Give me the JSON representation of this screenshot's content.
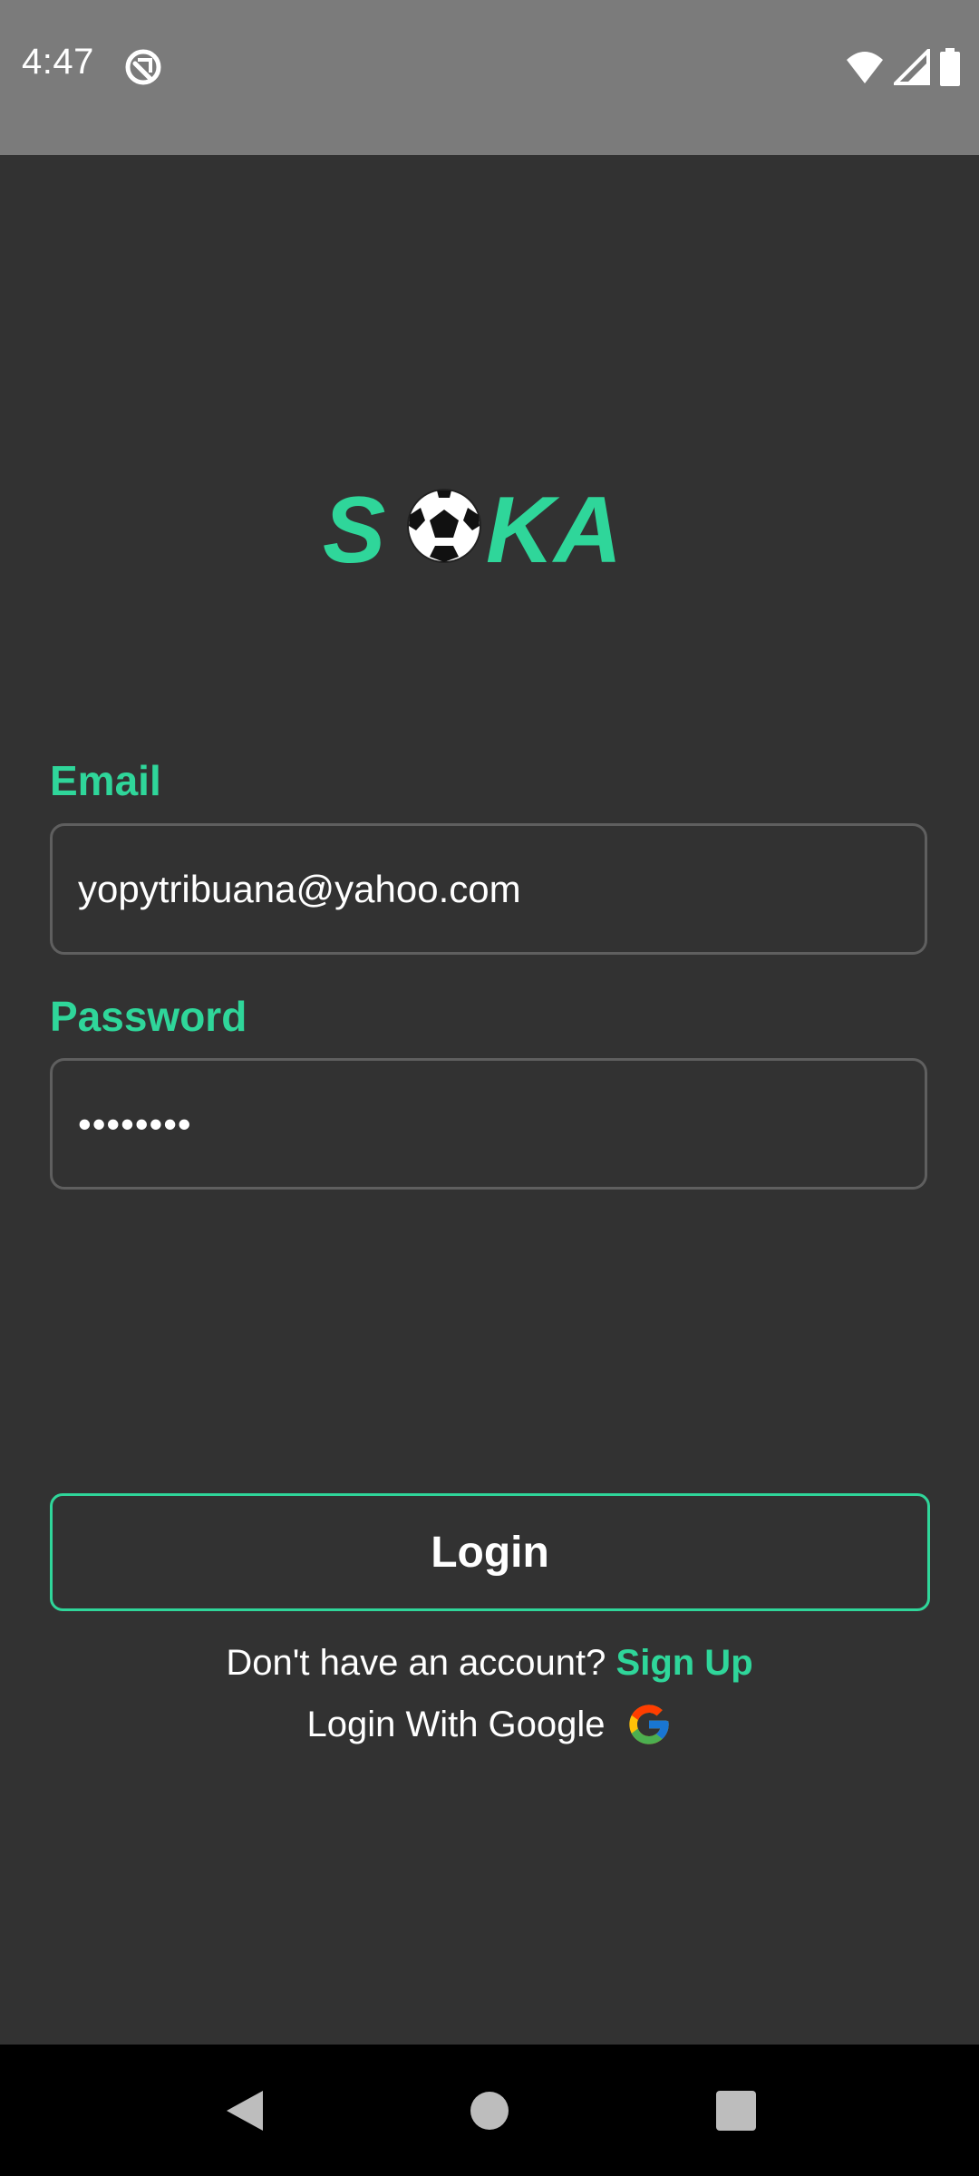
{
  "status_bar": {
    "time": "4:47"
  },
  "app": {
    "logo_text": "SOKA"
  },
  "form": {
    "email_label": "Email",
    "email_value": "yopytribuana@yahoo.com",
    "password_label": "Password",
    "password_value": "••••••••"
  },
  "actions": {
    "login_label": "Login",
    "signup_prompt": "Don't have an account?",
    "signup_link": "Sign Up",
    "google_label": "Login With Google"
  },
  "colors": {
    "accent": "#2fd69a",
    "background": "#323232",
    "status_bar": "#7b7b7b",
    "nav_bar": "#000000"
  },
  "icons": {
    "status_sync": "sync-off-icon",
    "wifi": "wifi-icon",
    "signal": "cell-signal-icon",
    "battery": "battery-icon",
    "google": "google-g-icon",
    "back": "back-triangle-icon",
    "home": "home-circle-icon",
    "recents": "recents-square-icon",
    "ball": "soccer-ball-icon"
  }
}
